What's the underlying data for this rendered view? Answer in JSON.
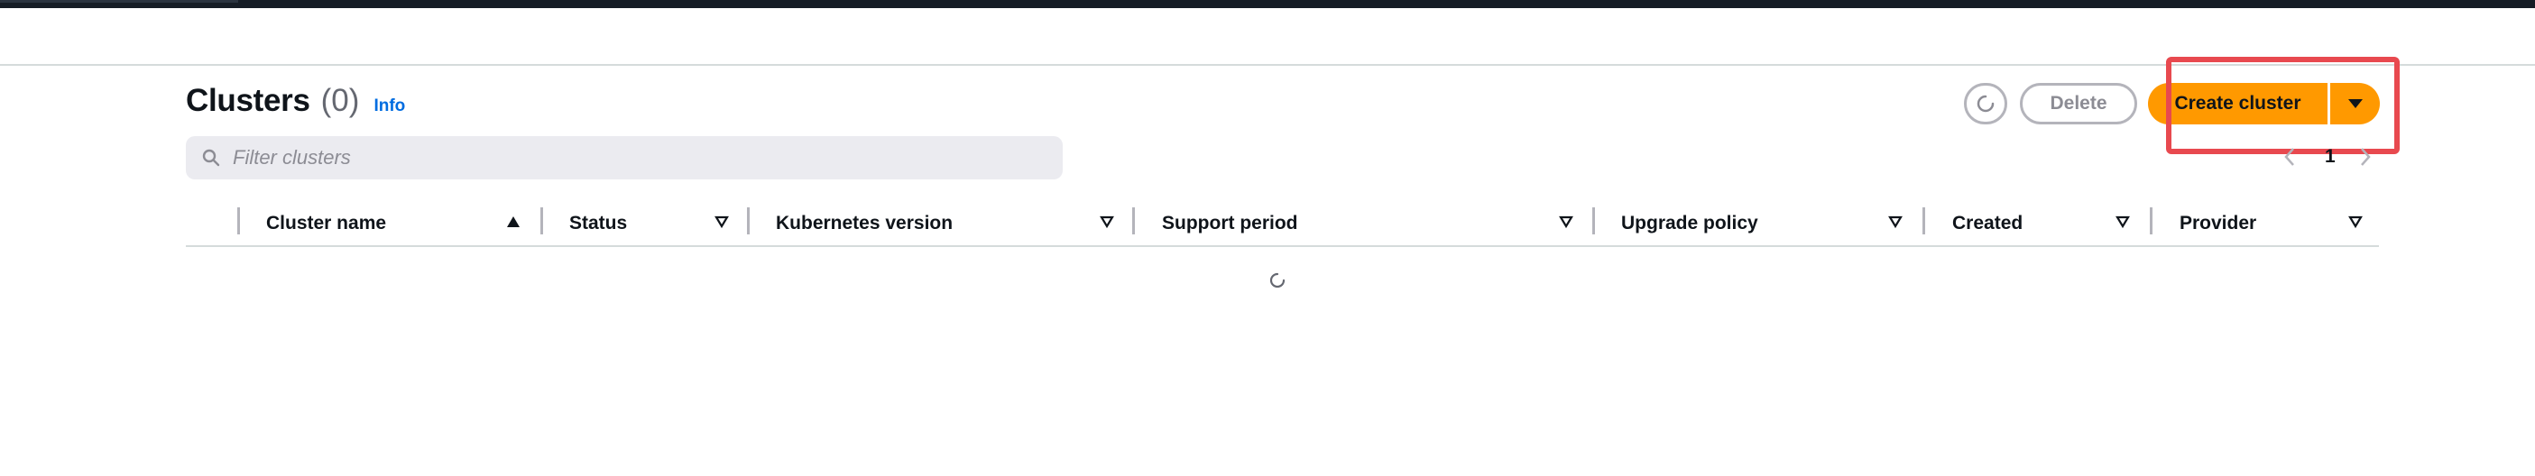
{
  "header": {
    "title": "Clusters",
    "count": "(0)",
    "info_label": "Info"
  },
  "search": {
    "placeholder": "Filter clusters",
    "value": ""
  },
  "actions": {
    "refresh_icon": "refresh-icon",
    "delete_label": "Delete",
    "create_label": "Create cluster",
    "create_dropdown_icon": "caret-down-icon"
  },
  "pagination": {
    "current_page": "1"
  },
  "table": {
    "columns": [
      {
        "label": "Cluster name",
        "sort": "ascending"
      },
      {
        "label": "Status",
        "sort": "none"
      },
      {
        "label": "Kubernetes version",
        "sort": "none"
      },
      {
        "label": "Support period",
        "sort": "none"
      },
      {
        "label": "Upgrade policy",
        "sort": "none"
      },
      {
        "label": "Created",
        "sort": "none"
      },
      {
        "label": "Provider",
        "sort": "none"
      }
    ],
    "rows": [],
    "state": "loading"
  },
  "colors": {
    "accent": "#ff9900",
    "link": "#006ce0",
    "highlight": "#e8494f",
    "topbar": "#161d26"
  }
}
